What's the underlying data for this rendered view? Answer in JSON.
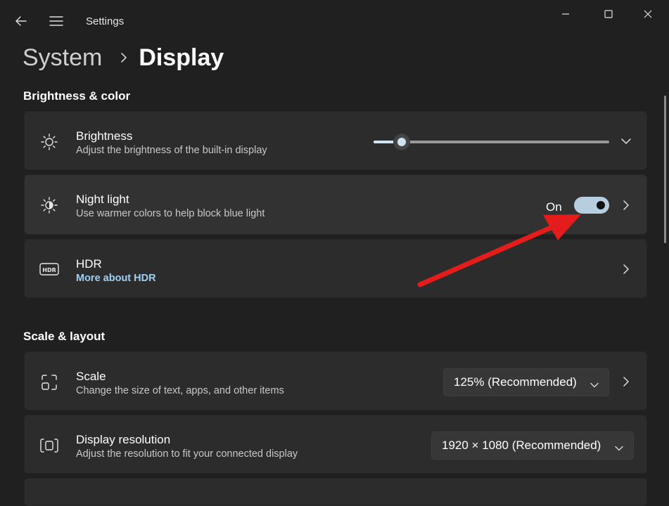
{
  "app": {
    "title": "Settings"
  },
  "breadcrumb": {
    "parent": "System",
    "current": "Display"
  },
  "sections": {
    "brightness_color": "Brightness & color",
    "scale_layout": "Scale & layout"
  },
  "brightness": {
    "title": "Brightness",
    "subtitle": "Adjust the brightness of the built-in display",
    "level": 0.12,
    "icon": "sun-icon"
  },
  "night_light": {
    "title": "Night light",
    "subtitle": "Use warmer colors to help block blue light",
    "state_label": "On",
    "enabled": true,
    "icon": "night-light-icon"
  },
  "hdr": {
    "title": "HDR",
    "link": "More about HDR",
    "icon": "hdr-icon"
  },
  "scale": {
    "title": "Scale",
    "subtitle": "Change the size of text, apps, and other items",
    "value": "125% (Recommended)",
    "icon": "scale-icon"
  },
  "resolution": {
    "title": "Display resolution",
    "subtitle": "Adjust the resolution to fit your connected display",
    "value": "1920 × 1080 (Recommended)",
    "icon": "resolution-icon"
  },
  "colors": {
    "background": "#202020",
    "card": "#2c2c2c",
    "accent": "#b7cde0",
    "link": "#9fd0f3",
    "annotation_arrow": "#e51c1c"
  }
}
